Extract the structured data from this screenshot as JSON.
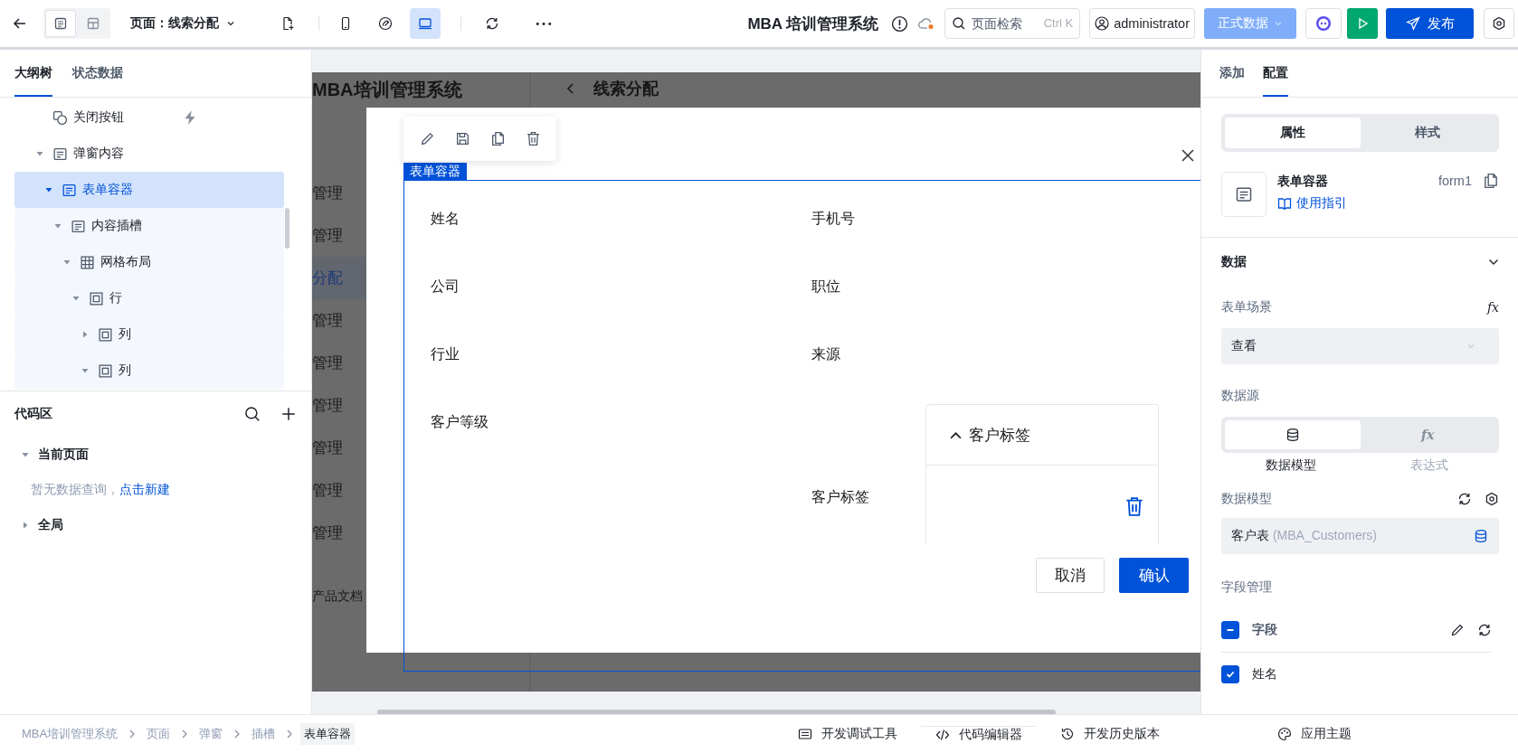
{
  "toolbar": {
    "view_toggles": [
      {
        "kind": "outline",
        "selected": true
      },
      {
        "kind": "layout",
        "selected": false
      }
    ],
    "page_selector": "页面：线索分配",
    "devices": [
      {
        "kind": "mobile",
        "selected": false
      },
      {
        "kind": "link",
        "selected": false
      },
      {
        "kind": "desktop",
        "selected": true
      }
    ],
    "app_title": "MBA 培训管理系统",
    "search": {
      "placeholder": "页面检索",
      "shortcut": "Ctrl K"
    },
    "user": "administrator",
    "data_env": "正式数据",
    "publish": "发布"
  },
  "left_panel": {
    "tabs": [
      {
        "label": "大纲树",
        "selected": true
      },
      {
        "label": "状态数据",
        "selected": false
      }
    ],
    "tree": [
      {
        "label": "关闭按钮",
        "kind": "button",
        "event": true,
        "selected": false
      },
      {
        "label": "弹窗内容",
        "kind": "form",
        "expanded": true,
        "selected": false,
        "children": [
          {
            "label": "表单容器",
            "kind": "form",
            "expanded": true,
            "selected": true,
            "children": [
              {
                "label": "内容插槽",
                "kind": "form",
                "expanded": true,
                "selected": false,
                "children": [
                  {
                    "label": "网格布局",
                    "kind": "grid",
                    "expanded": true,
                    "selected": false,
                    "children": [
                      {
                        "label": "行",
                        "kind": "square",
                        "expanded": true,
                        "selected": false,
                        "children": [
                          {
                            "label": "列",
                            "kind": "square",
                            "expanded": false,
                            "selected": false
                          },
                          {
                            "label": "列",
                            "kind": "square",
                            "expanded": true,
                            "selected": false
                          }
                        ]
                      }
                    ]
                  }
                ]
              }
            ]
          }
        ]
      }
    ],
    "code_area": {
      "title": "代码区",
      "groups": [
        {
          "label": "当前页面",
          "expanded": true,
          "empty_text": "暂无数据查询，",
          "link": "点击新建"
        },
        {
          "label": "全局",
          "expanded": false
        }
      ]
    }
  },
  "canvas": {
    "background_page": {
      "title": "MBA培训管理系统",
      "page_title": "线索分配",
      "menu": [
        {
          "label": "管理",
          "selected": false
        },
        {
          "label": "管理",
          "selected": false
        },
        {
          "label": "分配",
          "selected": true
        },
        {
          "label": "管理",
          "selected": false
        },
        {
          "label": "管理",
          "selected": false
        },
        {
          "label": "管理",
          "selected": false
        },
        {
          "label": "管理",
          "selected": false
        },
        {
          "label": "管理",
          "selected": false
        },
        {
          "label": "管理",
          "selected": false
        }
      ],
      "footer_link": "产品文档"
    },
    "selection_tag": "表单容器",
    "modal": {
      "fields": [
        {
          "label": "姓名",
          "kind": "text"
        },
        {
          "label": "手机号",
          "kind": "text"
        },
        {
          "label": "公司",
          "kind": "text"
        },
        {
          "label": "职位",
          "kind": "text"
        },
        {
          "label": "行业",
          "kind": "text"
        },
        {
          "label": "来源",
          "kind": "text"
        },
        {
          "label": "客户等级",
          "kind": "text"
        },
        {
          "label": "客户标签",
          "kind": "subform",
          "subform": {
            "title": "客户标签",
            "expanded": true
          }
        }
      ],
      "buttons": [
        {
          "label": "取消",
          "kind": "secondary"
        },
        {
          "label": "确认",
          "kind": "primary"
        }
      ]
    }
  },
  "right_panel": {
    "tabs": [
      {
        "label": "添加",
        "selected": false
      },
      {
        "label": "配置",
        "selected": true
      }
    ],
    "mode_tabs": [
      {
        "label": "属性",
        "selected": true
      },
      {
        "label": "样式",
        "selected": false
      }
    ],
    "component": {
      "name": "表单容器",
      "guide_link": "使用指引",
      "id": "form1"
    },
    "section": {
      "title": "数据",
      "expanded": true
    },
    "scene": {
      "label": "表单场景",
      "fx": "fx",
      "value": "查看"
    },
    "source": {
      "label": "数据源",
      "options": [
        {
          "kind": "model",
          "label": "数据模型",
          "selected": true
        },
        {
          "kind": "expression",
          "icon_text": "fx",
          "label": "表达式",
          "selected": false
        }
      ]
    },
    "model": {
      "label": "数据模型",
      "value": "客户表",
      "detail": "(MBA_Customers)"
    },
    "fields": {
      "label": "字段管理",
      "all": {
        "label": "字段",
        "indeterminate": true
      },
      "items": [
        {
          "label": "姓名",
          "checked": true
        }
      ]
    }
  },
  "status_bar": {
    "breadcrumb": [
      {
        "label": "MBA培训管理系统",
        "selected": false
      },
      {
        "label": "页面",
        "selected": false
      },
      {
        "label": "弹窗",
        "selected": false
      },
      {
        "label": "插槽",
        "selected": false
      },
      {
        "label": "表单容器",
        "selected": true
      }
    ],
    "tools": [
      {
        "label": "开发调试工具",
        "kind": "debug"
      },
      {
        "label": "代码编辑器",
        "kind": "code"
      },
      {
        "label": "开发历史版本",
        "kind": "history"
      },
      {
        "label": "应用主题",
        "kind": "theme"
      }
    ]
  }
}
